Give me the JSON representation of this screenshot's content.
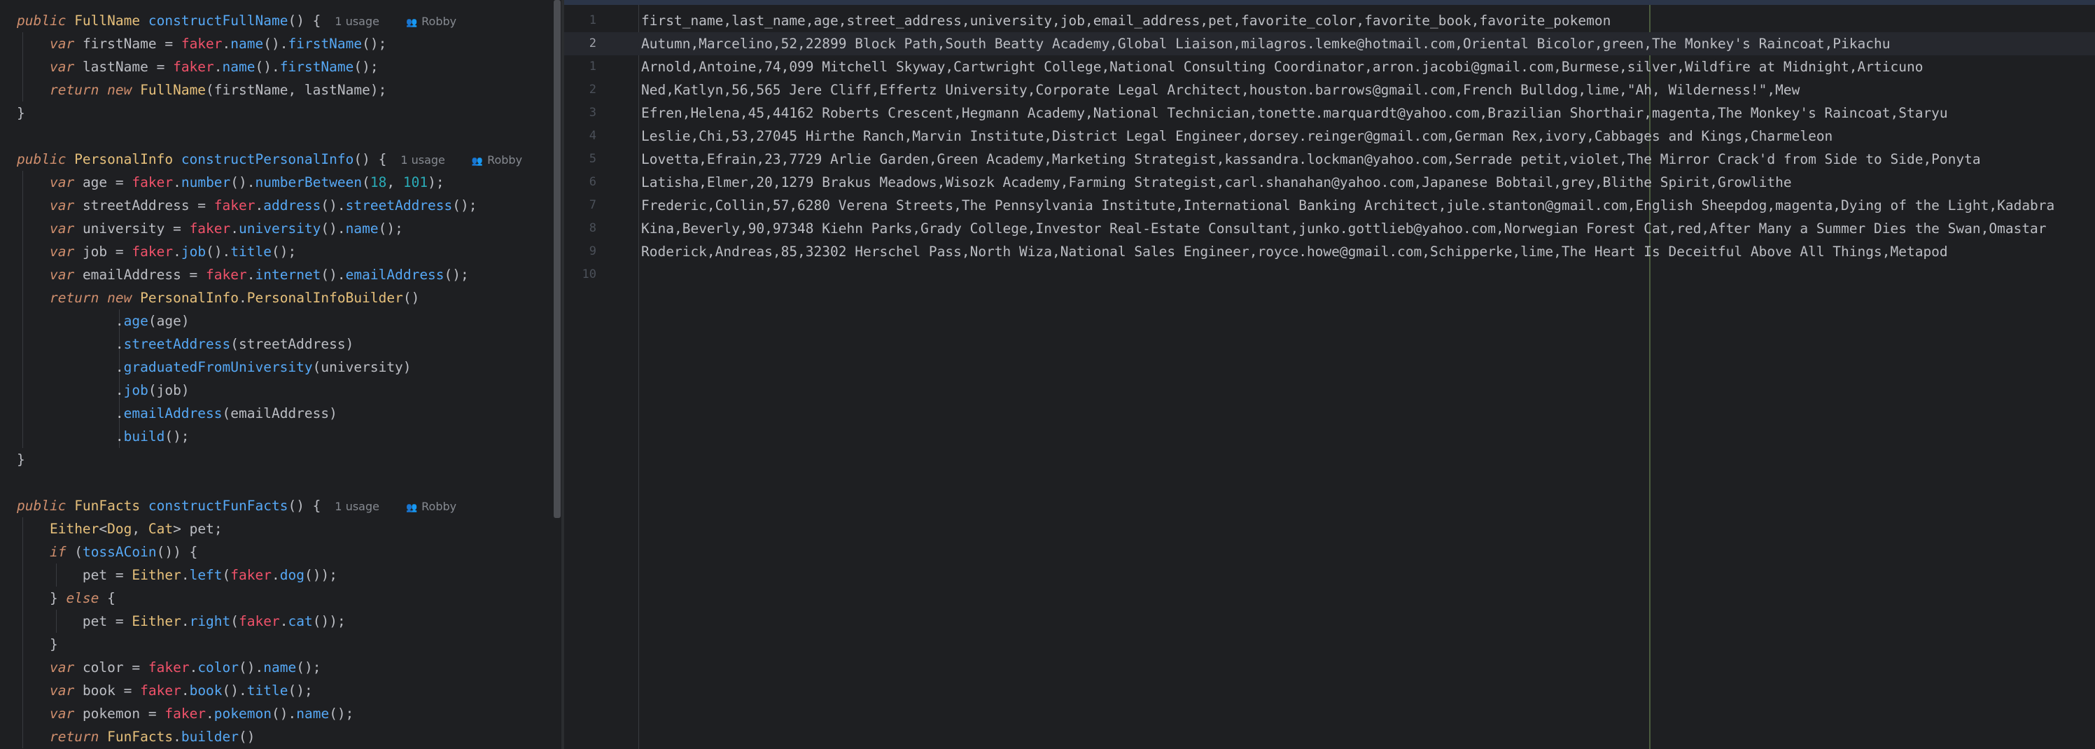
{
  "left_editor": {
    "lines": [
      [
        [
          "kw",
          "public "
        ],
        [
          "ty",
          "FullName "
        ],
        [
          "me",
          "constructFullName"
        ],
        [
          "",
          "() {"
        ],
        [
          "inlay",
          "1 usage"
        ],
        [
          "inlay-user",
          "Robby"
        ]
      ],
      [
        [
          "",
          "    "
        ],
        [
          "kw",
          "var "
        ],
        [
          "",
          "firstName = "
        ],
        [
          "fk",
          "faker"
        ],
        [
          "",
          "."
        ],
        [
          "me",
          "name"
        ],
        [
          "",
          "()."
        ],
        [
          "me",
          "firstName"
        ],
        [
          "",
          "();"
        ]
      ],
      [
        [
          "",
          "    "
        ],
        [
          "kw",
          "var "
        ],
        [
          "",
          "lastName = "
        ],
        [
          "fk",
          "faker"
        ],
        [
          "",
          "."
        ],
        [
          "me",
          "name"
        ],
        [
          "",
          "()."
        ],
        [
          "me",
          "firstName"
        ],
        [
          "",
          "();"
        ]
      ],
      [
        [
          "",
          "    "
        ],
        [
          "kw",
          "return "
        ],
        [
          "kw",
          "new "
        ],
        [
          "ty",
          "FullName"
        ],
        [
          "",
          "(firstName, lastName);"
        ]
      ],
      [
        [
          "",
          "}"
        ]
      ],
      [
        [
          "",
          ""
        ]
      ],
      [
        [
          "kw",
          "public "
        ],
        [
          "ty",
          "PersonalInfo "
        ],
        [
          "me",
          "constructPersonalInfo"
        ],
        [
          "",
          "() {"
        ],
        [
          "inlay",
          "1 usage"
        ],
        [
          "inlay-user",
          "Robby"
        ]
      ],
      [
        [
          "",
          "    "
        ],
        [
          "kw",
          "var "
        ],
        [
          "",
          "age = "
        ],
        [
          "fk",
          "faker"
        ],
        [
          "",
          "."
        ],
        [
          "me",
          "number"
        ],
        [
          "",
          "()."
        ],
        [
          "me",
          "numberBetween"
        ],
        [
          "",
          "("
        ],
        [
          "nu",
          "18"
        ],
        [
          "",
          ", "
        ],
        [
          "nu",
          "101"
        ],
        [
          "",
          ");"
        ]
      ],
      [
        [
          "",
          "    "
        ],
        [
          "kw",
          "var "
        ],
        [
          "",
          "streetAddress = "
        ],
        [
          "fk",
          "faker"
        ],
        [
          "",
          "."
        ],
        [
          "me",
          "address"
        ],
        [
          "",
          "()."
        ],
        [
          "me",
          "streetAddress"
        ],
        [
          "",
          "();"
        ]
      ],
      [
        [
          "",
          "    "
        ],
        [
          "kw",
          "var "
        ],
        [
          "",
          "university = "
        ],
        [
          "fk",
          "faker"
        ],
        [
          "",
          "."
        ],
        [
          "me",
          "university"
        ],
        [
          "",
          "()."
        ],
        [
          "me",
          "name"
        ],
        [
          "",
          "();"
        ]
      ],
      [
        [
          "",
          "    "
        ],
        [
          "kw",
          "var "
        ],
        [
          "",
          "job = "
        ],
        [
          "fk",
          "faker"
        ],
        [
          "",
          "."
        ],
        [
          "me",
          "job"
        ],
        [
          "",
          "()."
        ],
        [
          "me",
          "title"
        ],
        [
          "",
          "();"
        ]
      ],
      [
        [
          "",
          "    "
        ],
        [
          "kw",
          "var "
        ],
        [
          "",
          "emailAddress = "
        ],
        [
          "fk",
          "faker"
        ],
        [
          "",
          "."
        ],
        [
          "me",
          "internet"
        ],
        [
          "",
          "()."
        ],
        [
          "me",
          "emailAddress"
        ],
        [
          "",
          "();"
        ]
      ],
      [
        [
          "",
          "    "
        ],
        [
          "kw",
          "return "
        ],
        [
          "kw",
          "new "
        ],
        [
          "ty",
          "PersonalInfo"
        ],
        [
          "",
          "."
        ],
        [
          "ty",
          "PersonalInfoBuilder"
        ],
        [
          "",
          "()"
        ]
      ],
      [
        [
          "",
          "            ."
        ],
        [
          "me",
          "age"
        ],
        [
          "",
          "(age)"
        ]
      ],
      [
        [
          "",
          "            ."
        ],
        [
          "me",
          "streetAddress"
        ],
        [
          "",
          "(streetAddress)"
        ]
      ],
      [
        [
          "",
          "            ."
        ],
        [
          "me",
          "graduatedFromUniversity"
        ],
        [
          "",
          "(university)"
        ]
      ],
      [
        [
          "",
          "            ."
        ],
        [
          "me",
          "job"
        ],
        [
          "",
          "(job)"
        ]
      ],
      [
        [
          "",
          "            ."
        ],
        [
          "me",
          "emailAddress"
        ],
        [
          "",
          "(emailAddress)"
        ]
      ],
      [
        [
          "",
          "            ."
        ],
        [
          "me",
          "build"
        ],
        [
          "",
          "();"
        ]
      ],
      [
        [
          "",
          "}"
        ]
      ],
      [
        [
          "",
          ""
        ]
      ],
      [
        [
          "kw",
          "public "
        ],
        [
          "ty",
          "FunFacts "
        ],
        [
          "me",
          "constructFunFacts"
        ],
        [
          "",
          "() {"
        ],
        [
          "inlay",
          "1 usage"
        ],
        [
          "inlay-user",
          "Robby"
        ]
      ],
      [
        [
          "",
          "    "
        ],
        [
          "ty",
          "Either"
        ],
        [
          "",
          "<"
        ],
        [
          "ty",
          "Dog"
        ],
        [
          "",
          ", "
        ],
        [
          "ty",
          "Cat"
        ],
        [
          "",
          "> pet;"
        ]
      ],
      [
        [
          "",
          "    "
        ],
        [
          "kw",
          "if "
        ],
        [
          "",
          "("
        ],
        [
          "me",
          "tossACoin"
        ],
        [
          "",
          "()) {"
        ]
      ],
      [
        [
          "",
          "        pet = "
        ],
        [
          "ty",
          "Either"
        ],
        [
          "",
          "."
        ],
        [
          "me",
          "left"
        ],
        [
          "",
          "("
        ],
        [
          "fk",
          "faker"
        ],
        [
          "",
          "."
        ],
        [
          "me",
          "dog"
        ],
        [
          "",
          "());"
        ]
      ],
      [
        [
          "",
          "    } "
        ],
        [
          "kw",
          "else "
        ],
        [
          "",
          "{"
        ]
      ],
      [
        [
          "",
          "        pet = "
        ],
        [
          "ty",
          "Either"
        ],
        [
          "",
          "."
        ],
        [
          "me",
          "right"
        ],
        [
          "",
          "("
        ],
        [
          "fk",
          "faker"
        ],
        [
          "",
          "."
        ],
        [
          "me",
          "cat"
        ],
        [
          "",
          "());"
        ]
      ],
      [
        [
          "",
          "    }"
        ]
      ],
      [
        [
          "",
          "    "
        ],
        [
          "kw",
          "var "
        ],
        [
          "",
          "color = "
        ],
        [
          "fk",
          "faker"
        ],
        [
          "",
          "."
        ],
        [
          "me",
          "color"
        ],
        [
          "",
          "()."
        ],
        [
          "me",
          "name"
        ],
        [
          "",
          "();"
        ]
      ],
      [
        [
          "",
          "    "
        ],
        [
          "kw",
          "var "
        ],
        [
          "",
          "book = "
        ],
        [
          "fk",
          "faker"
        ],
        [
          "",
          "."
        ],
        [
          "me",
          "book"
        ],
        [
          "",
          "()."
        ],
        [
          "me",
          "title"
        ],
        [
          "",
          "();"
        ]
      ],
      [
        [
          "",
          "    "
        ],
        [
          "kw",
          "var "
        ],
        [
          "",
          "pokemon = "
        ],
        [
          "fk",
          "faker"
        ],
        [
          "",
          "."
        ],
        [
          "me",
          "pokemon"
        ],
        [
          "",
          "()."
        ],
        [
          "me",
          "name"
        ],
        [
          "",
          "();"
        ]
      ],
      [
        [
          "",
          "    "
        ],
        [
          "kw",
          "return "
        ],
        [
          "ty",
          "FunFacts"
        ],
        [
          "",
          "."
        ],
        [
          "me",
          "builder"
        ],
        [
          "",
          "()"
        ]
      ]
    ]
  },
  "csv_editor": {
    "current_line_index": 1,
    "line_numbers": [
      "1",
      "2",
      "1",
      "2",
      "3",
      "4",
      "5",
      "6",
      "7",
      "8",
      "9",
      "10"
    ],
    "lines": [
      "first_name,last_name,age,street_address,university,job,email_address,pet,favorite_color,favorite_book,favorite_pokemon",
      "Autumn,Marcelino,52,22899 Block Path,South Beatty Academy,Global Liaison,milagros.lemke@hotmail.com,Oriental Bicolor,green,The Monkey's Raincoat,Pikachu",
      "Arnold,Antoine,74,099 Mitchell Skyway,Cartwright College,National Consulting Coordinator,arron.jacobi@gmail.com,Burmese,silver,Wildfire at Midnight,Articuno",
      "Ned,Katlyn,56,565 Jere Cliff,Effertz University,Corporate Legal Architect,houston.barrows@gmail.com,French Bulldog,lime,\"Ah, Wilderness!\",Mew",
      "Efren,Helena,45,44162 Roberts Crescent,Hegmann Academy,National Technician,tonette.marquardt@yahoo.com,Brazilian Shorthair,magenta,The Monkey's Raincoat,Staryu",
      "Leslie,Chi,53,27045 Hirthe Ranch,Marvin Institute,District Legal Engineer,dorsey.reinger@gmail.com,German Rex,ivory,Cabbages and Kings,Charmeleon",
      "Lovetta,Efrain,23,7729 Arlie Garden,Green Academy,Marketing Strategist,kassandra.lockman@yahoo.com,Serrade petit,violet,The Mirror Crack'd from Side to Side,Ponyta",
      "Latisha,Elmer,20,1279 Brakus Meadows,Wisozk Academy,Farming Strategist,carl.shanahan@yahoo.com,Japanese Bobtail,grey,Blithe Spirit,Growlithe",
      "Frederic,Collin,57,6280 Verena Streets,The Pennsylvania Institute,International Banking Architect,jule.stanton@gmail.com,English Sheepdog,magenta,Dying of the Light,Kadabra",
      "Kina,Beverly,90,97348 Kiehn Parks,Grady College,Investor Real-Estate Consultant,junko.gottlieb@yahoo.com,Norwegian Forest Cat,red,After Many a Summer Dies the Swan,Omastar",
      "Roderick,Andreas,85,32302 Herschel Pass,North Wiza,National Sales Engineer,royce.howe@gmail.com,Schipperke,lime,The Heart Is Deceitful Above All Things,Metapod",
      ""
    ]
  },
  "colors": {
    "background": "#1e1f22",
    "keyword": "#cf8e6d",
    "type": "#e6c07b",
    "method": "#56a8f5",
    "faker": "#f0526a",
    "number": "#2aacb8",
    "text": "#bcbec4"
  }
}
